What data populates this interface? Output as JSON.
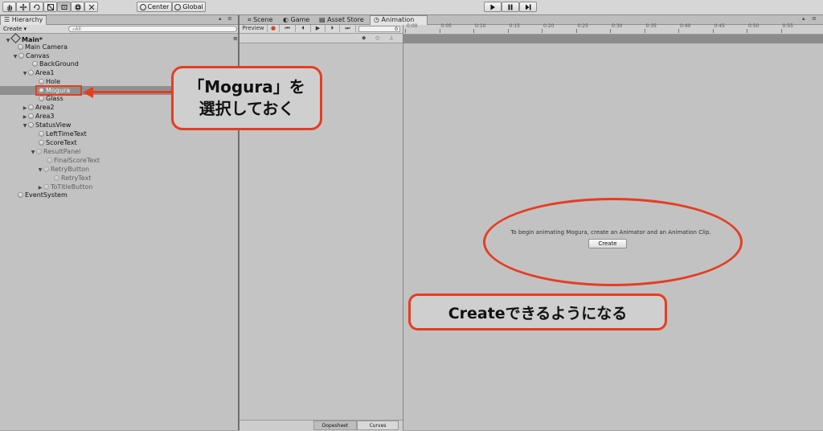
{
  "toolbar": {
    "tool_icons": [
      "hand-icon",
      "move-icon",
      "rotate-icon",
      "scale-icon",
      "rect-icon",
      "transform-icon",
      "custom-tool-icon"
    ],
    "pivot_label": "Center",
    "space_label": "Global",
    "play_icons": [
      "play-icon",
      "pause-icon",
      "step-icon"
    ]
  },
  "hierarchy": {
    "tab_label": "Hierarchy",
    "create_label": "Create",
    "search_placeholder": "All",
    "scene_name": "Main*",
    "nodes": [
      {
        "label": "Main Camera"
      },
      {
        "label": "Canvas"
      },
      {
        "label": "BackGround"
      },
      {
        "label": "Area1"
      },
      {
        "label": "Hole"
      },
      {
        "label": "Mogura"
      },
      {
        "label": "Glass"
      },
      {
        "label": "Area2"
      },
      {
        "label": "Area3"
      },
      {
        "label": "StatusView"
      },
      {
        "label": "LeftTimeText"
      },
      {
        "label": "ScoreText"
      },
      {
        "label": "ResultPanel"
      },
      {
        "label": "FinalScoreText"
      },
      {
        "label": "RetryButton"
      },
      {
        "label": "RetryText"
      },
      {
        "label": "ToTitleButton"
      },
      {
        "label": "EventSystem"
      }
    ]
  },
  "tabs": {
    "scene": "Scene",
    "game": "Game",
    "asset_store": "Asset Store",
    "animation": "Animation"
  },
  "animation": {
    "preview_label": "Preview",
    "frame_value": "0",
    "timeline_ticks": [
      "0:00",
      "0:05",
      "0:10",
      "0:15",
      "0:20",
      "0:25",
      "0:30",
      "0:35",
      "0:40",
      "0:45",
      "0:50",
      "0:55"
    ],
    "message": "To begin animating Mogura, create an Animator and an Animation Clip.",
    "create_button": "Create",
    "dopesheet_label": "Dopesheet",
    "curves_label": "Curves"
  },
  "callouts": {
    "select_line1": "「Mogura」を",
    "select_line2": "選択しておく",
    "create_note": "Createできるようになる"
  },
  "colors": {
    "callout_border": "#e53d22",
    "selection": "#3d7bd6"
  }
}
